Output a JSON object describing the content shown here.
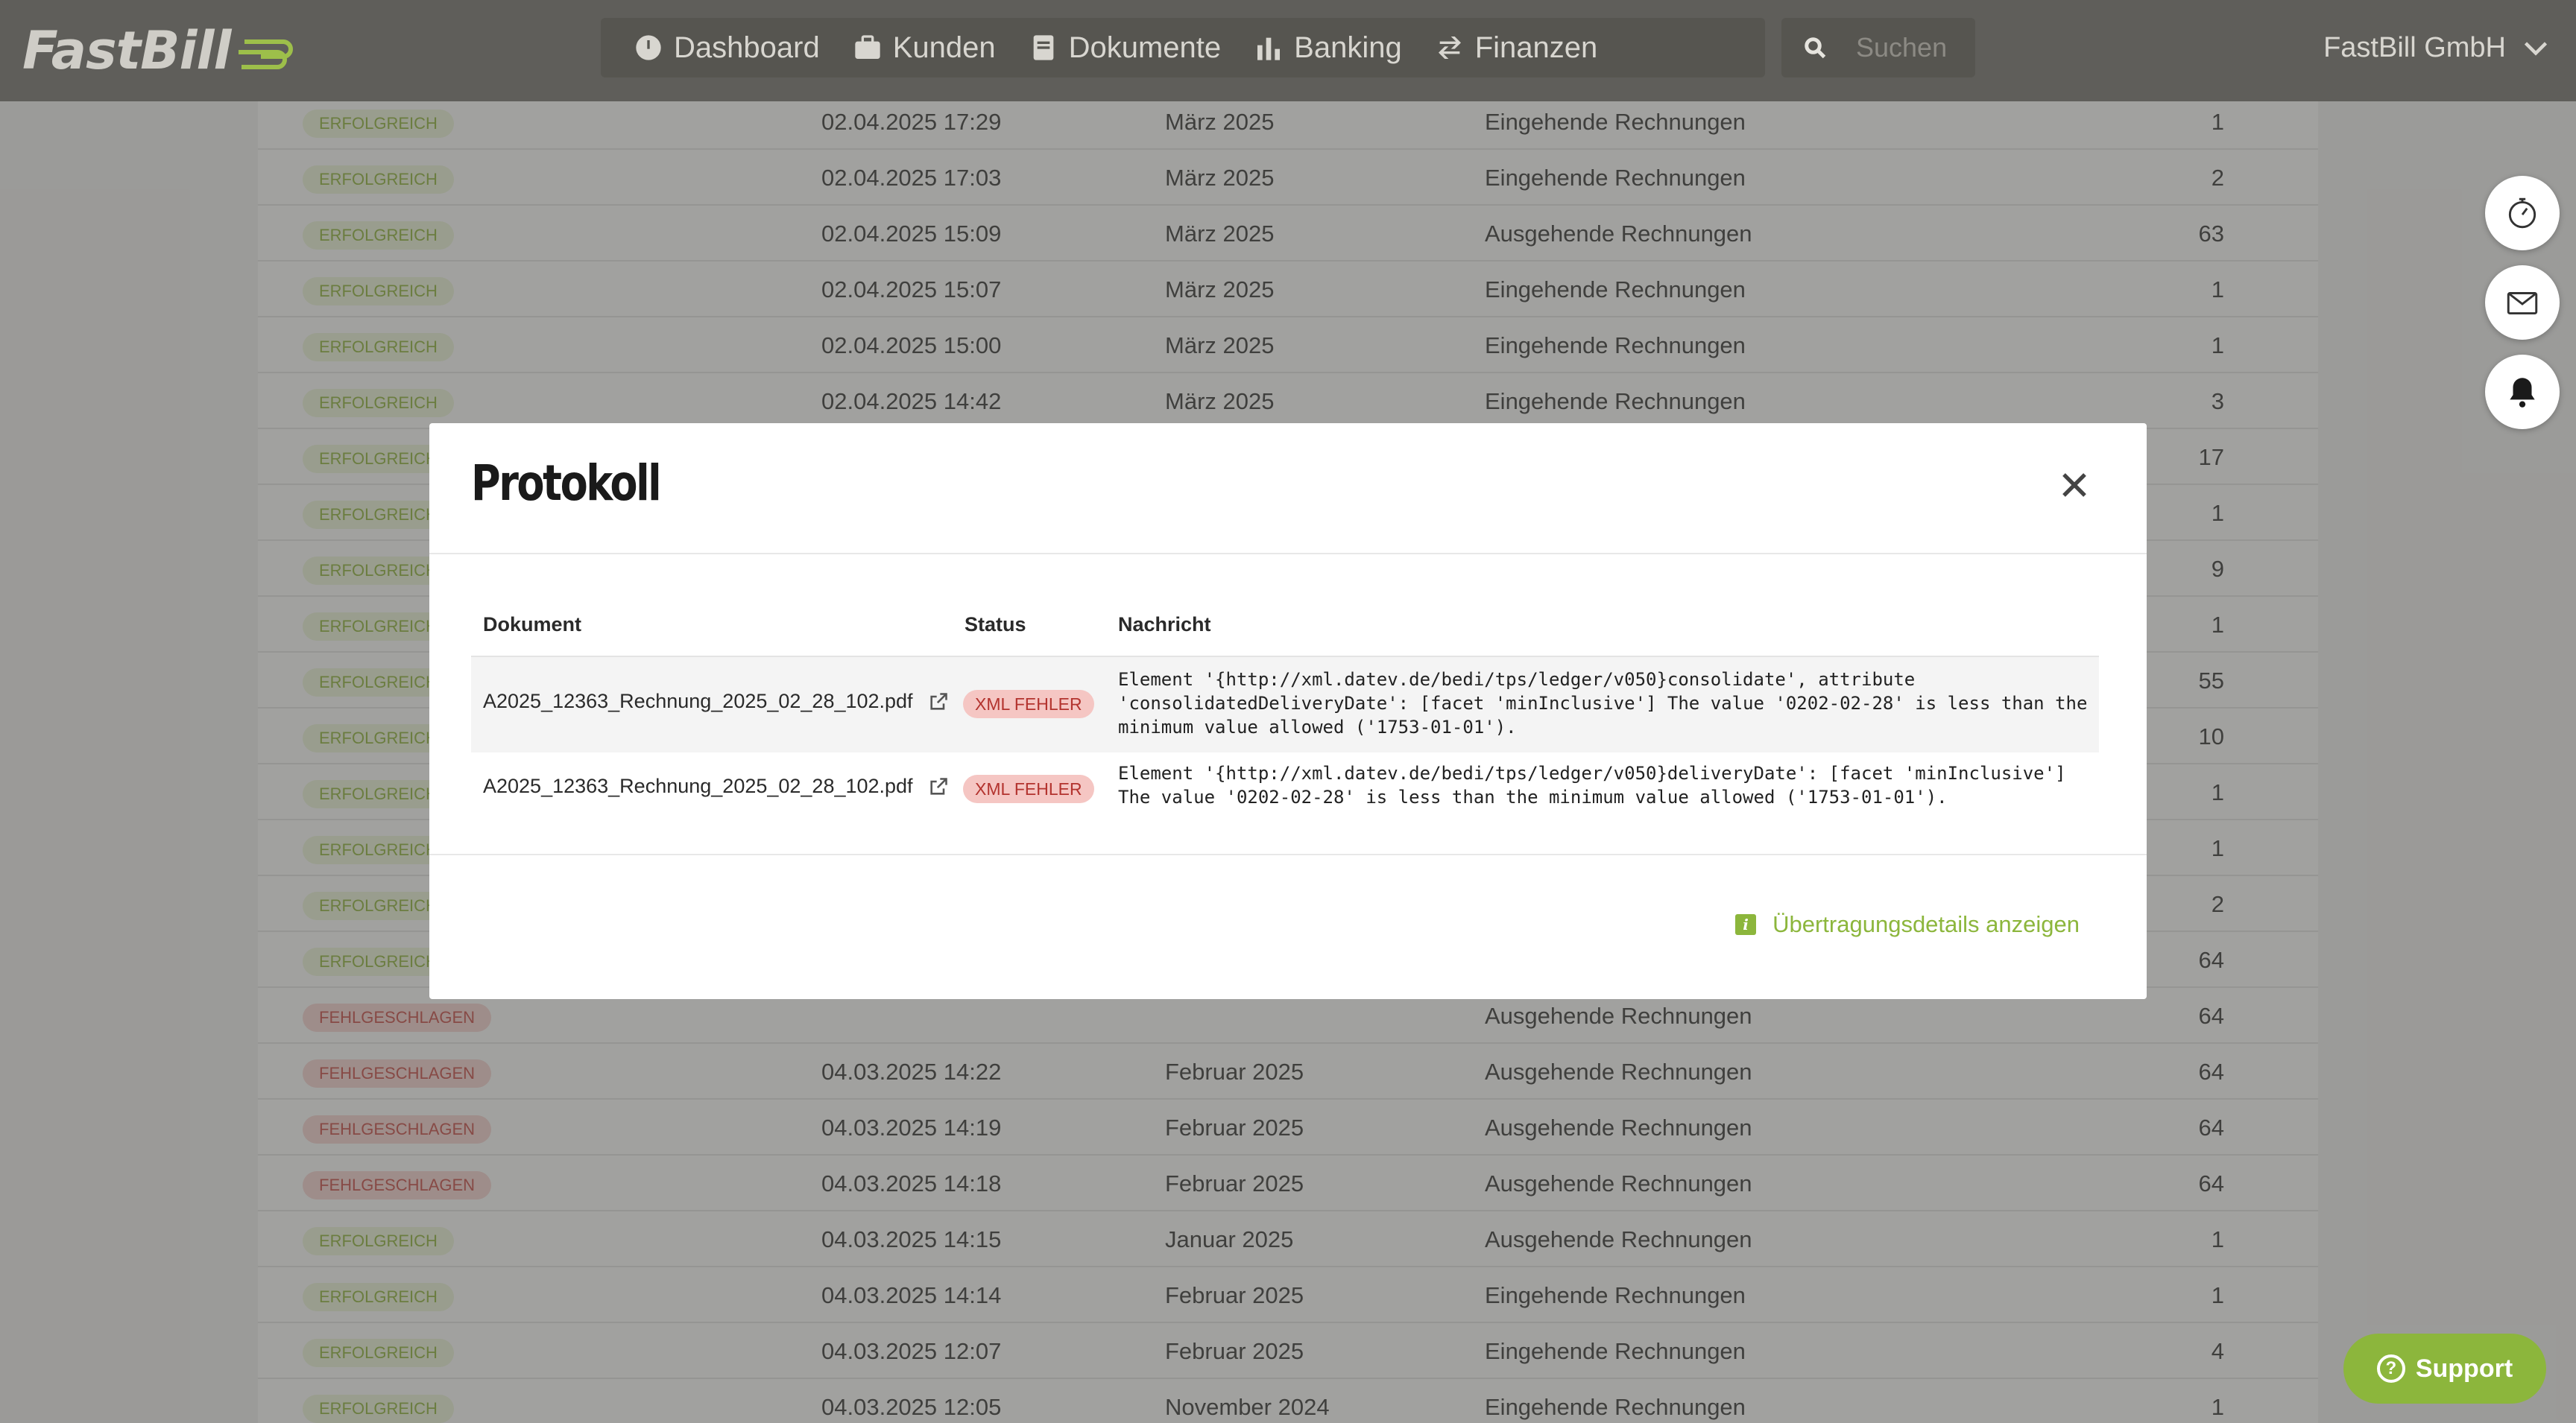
{
  "app": {
    "logo_text": "FastBill",
    "company": "FastBill GmbH",
    "search_placeholder": "Suchen",
    "nav": [
      {
        "label": "Dashboard",
        "icon": "dashboard-icon"
      },
      {
        "label": "Kunden",
        "icon": "briefcase-icon"
      },
      {
        "label": "Dokumente",
        "icon": "document-icon"
      },
      {
        "label": "Banking",
        "icon": "bar-chart-icon"
      },
      {
        "label": "Finanzen",
        "icon": "exchange-icon"
      }
    ],
    "support_label": "Support",
    "support_icon": "question-icon"
  },
  "background_table": {
    "rows": [
      {
        "status": "ERFOLGREICH",
        "status_kind": "ok",
        "date": "02.04.2025 17:29",
        "period": "März 2025",
        "type": "Eingehende Rechnungen",
        "count": "1"
      },
      {
        "status": "ERFOLGREICH",
        "status_kind": "ok",
        "date": "02.04.2025 17:03",
        "period": "März 2025",
        "type": "Eingehende Rechnungen",
        "count": "2"
      },
      {
        "status": "ERFOLGREICH",
        "status_kind": "ok",
        "date": "02.04.2025 15:09",
        "period": "März 2025",
        "type": "Ausgehende Rechnungen",
        "count": "63"
      },
      {
        "status": "ERFOLGREICH",
        "status_kind": "ok",
        "date": "02.04.2025 15:07",
        "period": "März 2025",
        "type": "Eingehende Rechnungen",
        "count": "1"
      },
      {
        "status": "ERFOLGREICH",
        "status_kind": "ok",
        "date": "02.04.2025 15:00",
        "period": "März 2025",
        "type": "Eingehende Rechnungen",
        "count": "1"
      },
      {
        "status": "ERFOLGREICH",
        "status_kind": "ok",
        "date": "02.04.2025 14:42",
        "period": "März 2025",
        "type": "Eingehende Rechnungen",
        "count": "3"
      },
      {
        "status": "ERFOLGREICH",
        "status_kind": "ok",
        "date": "",
        "period": "",
        "type": "",
        "count": "17"
      },
      {
        "status": "ERFOLGREICH",
        "status_kind": "ok",
        "date": "",
        "period": "",
        "type": "",
        "count": "1"
      },
      {
        "status": "ERFOLGREICH",
        "status_kind": "ok",
        "date": "",
        "period": "",
        "type": "",
        "count": "9"
      },
      {
        "status": "ERFOLGREICH",
        "status_kind": "ok",
        "date": "",
        "period": "",
        "type": "",
        "count": "1"
      },
      {
        "status": "ERFOLGREICH",
        "status_kind": "ok",
        "date": "",
        "period": "",
        "type": "",
        "count": "55"
      },
      {
        "status": "ERFOLGREICH",
        "status_kind": "ok",
        "date": "",
        "period": "",
        "type": "",
        "count": "10"
      },
      {
        "status": "ERFOLGREICH",
        "status_kind": "ok",
        "date": "",
        "period": "",
        "type": "",
        "count": "1"
      },
      {
        "status": "ERFOLGREICH",
        "status_kind": "ok",
        "date": "",
        "period": "",
        "type": "",
        "count": "1"
      },
      {
        "status": "ERFOLGREICH",
        "status_kind": "ok",
        "date": "",
        "period": "",
        "type": "",
        "count": "2"
      },
      {
        "status": "ERFOLGREICH",
        "status_kind": "ok",
        "date": "",
        "period": "",
        "type": "",
        "count": "64"
      },
      {
        "status": "FEHLGESCHLAGEN",
        "status_kind": "fail",
        "date": "",
        "period": "",
        "type": "Ausgehende Rechnungen",
        "count": "64"
      },
      {
        "status": "FEHLGESCHLAGEN",
        "status_kind": "fail",
        "date": "04.03.2025 14:22",
        "period": "Februar 2025",
        "type": "Ausgehende Rechnungen",
        "count": "64"
      },
      {
        "status": "FEHLGESCHLAGEN",
        "status_kind": "fail",
        "date": "04.03.2025 14:19",
        "period": "Februar 2025",
        "type": "Ausgehende Rechnungen",
        "count": "64"
      },
      {
        "status": "FEHLGESCHLAGEN",
        "status_kind": "fail",
        "date": "04.03.2025 14:18",
        "period": "Februar 2025",
        "type": "Ausgehende Rechnungen",
        "count": "64"
      },
      {
        "status": "ERFOLGREICH",
        "status_kind": "ok",
        "date": "04.03.2025 14:15",
        "period": "Januar 2025",
        "type": "Ausgehende Rechnungen",
        "count": "1"
      },
      {
        "status": "ERFOLGREICH",
        "status_kind": "ok",
        "date": "04.03.2025 14:14",
        "period": "Februar 2025",
        "type": "Eingehende Rechnungen",
        "count": "1"
      },
      {
        "status": "ERFOLGREICH",
        "status_kind": "ok",
        "date": "04.03.2025 12:07",
        "period": "Februar 2025",
        "type": "Eingehende Rechnungen",
        "count": "4"
      },
      {
        "status": "ERFOLGREICH",
        "status_kind": "ok",
        "date": "04.03.2025 12:05",
        "period": "November 2024",
        "type": "Eingehende Rechnungen",
        "count": "1"
      }
    ]
  },
  "modal": {
    "title": "Protokoll",
    "columns": {
      "document": "Dokument",
      "status": "Status",
      "message": "Nachricht"
    },
    "rows": [
      {
        "document": "A2025_12363_Rechnung_2025_02_28_102.pdf",
        "status": "XML FEHLER",
        "message": "Element '{http://xml.datev.de/bedi/tps/ledger/v050}consolidate', attribute 'consolidatedDeliveryDate': [facet 'minInclusive'] The value '0202-02-28' is less than the minimum value allowed ('1753-01-01')."
      },
      {
        "document": "A2025_12363_Rechnung_2025_02_28_102.pdf",
        "status": "XML FEHLER",
        "message": "Element '{http://xml.datev.de/bedi/tps/ledger/v050}deliveryDate': [facet 'minInclusive'] The value '0202-02-28' is less than the minimum value allowed ('1753-01-01')."
      }
    ],
    "details_link": "Übertragungsdetails anzeigen"
  },
  "colors": {
    "accent_green": "#8cb63c",
    "error_red": "#b3332e",
    "topbar": "#5f5e5a"
  }
}
